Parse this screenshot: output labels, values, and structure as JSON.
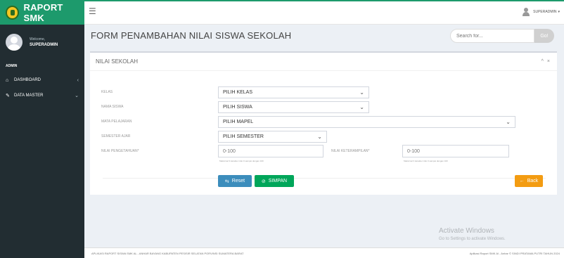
{
  "app": {
    "brand": "RAPORT SMK"
  },
  "user": {
    "welcome": "Welcome,",
    "name": "SUPERADMIN"
  },
  "sidebar": {
    "section": "ADMIN",
    "items": [
      {
        "label": "DASHBOARD",
        "icon": "home-icon",
        "arrow": "‹"
      },
      {
        "label": "DATA MASTER",
        "icon": "edit-icon",
        "arrow": "⌄"
      }
    ]
  },
  "topbar": {
    "user": "SUPERADMIN"
  },
  "page": {
    "title": "FORM PENAMBAHAN NILAI SISWA SEKOLAH"
  },
  "search": {
    "placeholder": "Search for...",
    "go_label": "Go!"
  },
  "card": {
    "title": "NILAI SEKOLAH",
    "tool_minimize": "^",
    "tool_close": "×"
  },
  "form": {
    "kelas": {
      "label": "KELAS",
      "value": "PILIH KELAS"
    },
    "siswa": {
      "label": "NAMA SISWA",
      "value": "PILIH SISWA"
    },
    "mapel": {
      "label": "MATA PELAJARAN",
      "value": "PILIH MAPEL"
    },
    "semester": {
      "label": "SEMESTER AJAR",
      "value": "PILIH SEMESTER"
    },
    "pengetahuan": {
      "label": "NILAI PENGETAHUAN*",
      "placeholder": "0-100",
      "hint": "Maksimal 3 karakter nilai 0 sampai dengan 100"
    },
    "keterampilan": {
      "label": "NILAI KETERAMPILAN*",
      "placeholder": "0-100",
      "hint": "Maksimal 3 karakter nilai 0 sampai dengan 100"
    }
  },
  "buttons": {
    "reset": "Reset",
    "save": "SIMPAN",
    "back": "Back"
  },
  "watermark": {
    "line1": "Activate Windows",
    "line2": "Go to Settings to activate Windows."
  },
  "footer": {
    "left": "APLIKASI RAPORT SISWA SMK AL - ANHAR BAYANG KABUPATEN PESISIR SELATAN PORVINSI SUMATERA BARAT",
    "right": "Aplikasi Raport SMK Al - Anhar © SINDI PRATAMA PUTRI TAHUN 2024"
  }
}
